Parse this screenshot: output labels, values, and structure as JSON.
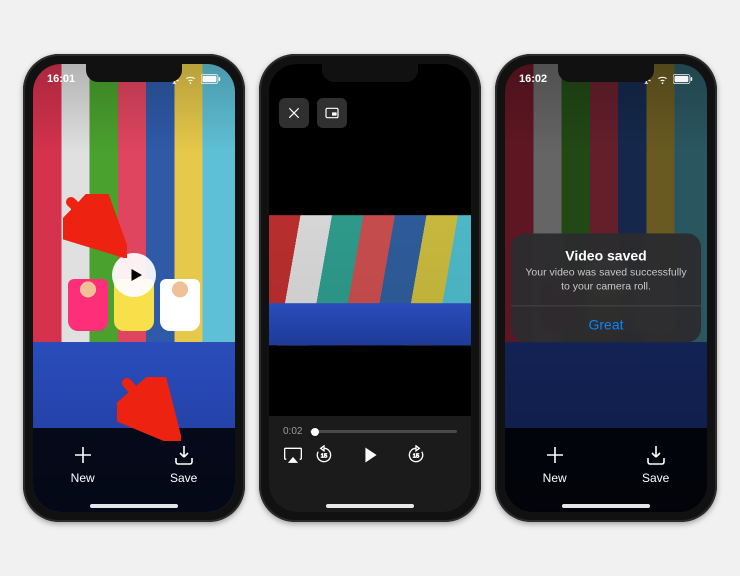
{
  "status": {
    "time": "16:01",
    "time2": "16:02"
  },
  "toolbar": {
    "new_label": "New",
    "save_label": "Save"
  },
  "player": {
    "elapsed": "0:02"
  },
  "alert": {
    "title": "Video saved",
    "message": "Your video was saved successfully to your camera roll.",
    "button": "Great"
  },
  "icons": {
    "play": "play-icon",
    "plus": "plus-icon",
    "download": "download-icon",
    "close": "close-icon",
    "pip": "pip-icon",
    "airplay": "airplay-icon",
    "back15": "back-15-icon",
    "fwd15": "forward-15-icon"
  }
}
